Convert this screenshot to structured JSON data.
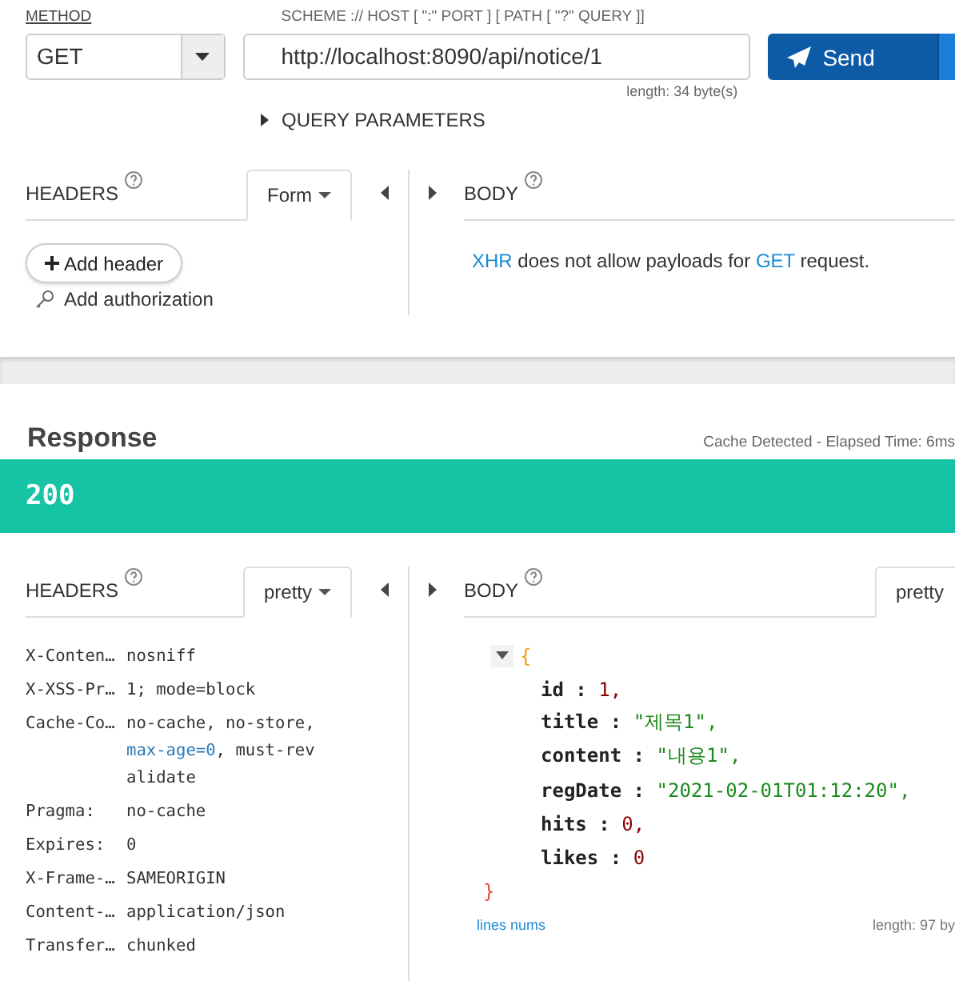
{
  "request": {
    "method_label": "METHOD",
    "method": "GET",
    "url_label": "SCHEME :// HOST [ \":\" PORT ] [ PATH [ \"?\" QUERY ]]",
    "url": "http://localhost:8090/api/notice/1",
    "length": "length: 34 byte(s)",
    "send": "Send",
    "query_parameters": {
      "label": "QUERY PARAMETERS",
      "expanded": false
    },
    "headers_panel": {
      "title": "HEADERS",
      "mode": "Form",
      "add_header": "Add header",
      "add_authorization": "Add authorization"
    },
    "body_panel": {
      "title": "BODY",
      "message": [
        {
          "kind": "link",
          "text": "XHR"
        },
        {
          "kind": "text",
          "text": " does not allow payloads for "
        },
        {
          "kind": "link",
          "text": "GET"
        },
        {
          "kind": "text",
          "text": " request."
        }
      ]
    }
  },
  "response": {
    "title": "Response",
    "timing": "Cache Detected - Elapsed Time: 6ms",
    "status": "200",
    "headers_panel": {
      "title": "HEADERS",
      "mode": "pretty"
    },
    "headers": [
      {
        "name": "X-Conten…",
        "segments": [
          {
            "kind": "plain",
            "text": "nosniff"
          }
        ]
      },
      {
        "name": "X-XSS-Pr…",
        "segments": [
          {
            "kind": "plain",
            "text": "1; mode=block"
          }
        ]
      },
      {
        "name": "Cache-Co…",
        "segments": [
          {
            "kind": "plain",
            "text": "no-cache, no-store, "
          },
          {
            "kind": "highlight",
            "text": "max-age=0"
          },
          {
            "kind": "plain",
            "text": ", must-revalidate"
          }
        ]
      },
      {
        "name": "Pragma:",
        "segments": [
          {
            "kind": "plain",
            "text": "no-cache"
          }
        ]
      },
      {
        "name": "Expires:",
        "segments": [
          {
            "kind": "plain",
            "text": "0"
          }
        ]
      },
      {
        "name": "X-Frame-…",
        "segments": [
          {
            "kind": "plain",
            "text": "SAMEORIGIN"
          }
        ]
      },
      {
        "name": "Content-…",
        "segments": [
          {
            "kind": "plain",
            "text": "application/json"
          }
        ]
      },
      {
        "name": "Transfer…",
        "segments": [
          {
            "kind": "plain",
            "text": "chunked"
          }
        ]
      }
    ],
    "body_panel": {
      "title": "BODY",
      "mode": "pretty"
    },
    "body": {
      "expanded": true,
      "open": "{",
      "close": "}",
      "fields": [
        {
          "key": "id :",
          "value": "1,",
          "kind": "number"
        },
        {
          "key": "title :",
          "value": "\"제목1\",",
          "kind": "string"
        },
        {
          "key": "content :",
          "value": "\"내용1\",",
          "kind": "string"
        },
        {
          "key": "regDate :",
          "value": "\"2021-02-01T01:12:20\",",
          "kind": "string"
        },
        {
          "key": "hits :",
          "value": "0,",
          "kind": "number"
        },
        {
          "key": "likes :",
          "value": "0",
          "kind": "number"
        }
      ]
    },
    "lines_nums": "lines nums",
    "length": "length: 97 by"
  }
}
